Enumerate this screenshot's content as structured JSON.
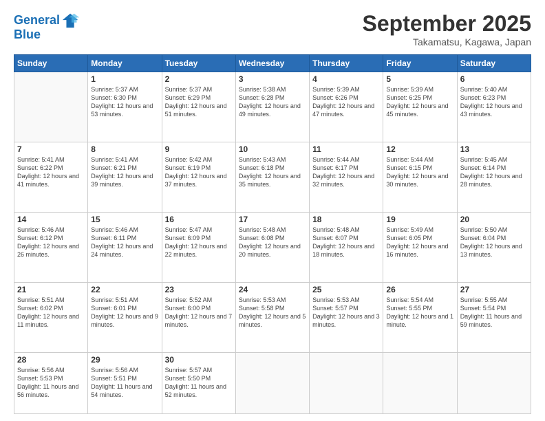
{
  "header": {
    "logo_line1": "General",
    "logo_line2": "Blue",
    "month_year": "September 2025",
    "location": "Takamatsu, Kagawa, Japan"
  },
  "days_of_week": [
    "Sunday",
    "Monday",
    "Tuesday",
    "Wednesday",
    "Thursday",
    "Friday",
    "Saturday"
  ],
  "weeks": [
    [
      {
        "day": "",
        "sunrise": "",
        "sunset": "",
        "daylight": ""
      },
      {
        "day": "1",
        "sunrise": "Sunrise: 5:37 AM",
        "sunset": "Sunset: 6:30 PM",
        "daylight": "Daylight: 12 hours and 53 minutes."
      },
      {
        "day": "2",
        "sunrise": "Sunrise: 5:37 AM",
        "sunset": "Sunset: 6:29 PM",
        "daylight": "Daylight: 12 hours and 51 minutes."
      },
      {
        "day": "3",
        "sunrise": "Sunrise: 5:38 AM",
        "sunset": "Sunset: 6:28 PM",
        "daylight": "Daylight: 12 hours and 49 minutes."
      },
      {
        "day": "4",
        "sunrise": "Sunrise: 5:39 AM",
        "sunset": "Sunset: 6:26 PM",
        "daylight": "Daylight: 12 hours and 47 minutes."
      },
      {
        "day": "5",
        "sunrise": "Sunrise: 5:39 AM",
        "sunset": "Sunset: 6:25 PM",
        "daylight": "Daylight: 12 hours and 45 minutes."
      },
      {
        "day": "6",
        "sunrise": "Sunrise: 5:40 AM",
        "sunset": "Sunset: 6:23 PM",
        "daylight": "Daylight: 12 hours and 43 minutes."
      }
    ],
    [
      {
        "day": "7",
        "sunrise": "Sunrise: 5:41 AM",
        "sunset": "Sunset: 6:22 PM",
        "daylight": "Daylight: 12 hours and 41 minutes."
      },
      {
        "day": "8",
        "sunrise": "Sunrise: 5:41 AM",
        "sunset": "Sunset: 6:21 PM",
        "daylight": "Daylight: 12 hours and 39 minutes."
      },
      {
        "day": "9",
        "sunrise": "Sunrise: 5:42 AM",
        "sunset": "Sunset: 6:19 PM",
        "daylight": "Daylight: 12 hours and 37 minutes."
      },
      {
        "day": "10",
        "sunrise": "Sunrise: 5:43 AM",
        "sunset": "Sunset: 6:18 PM",
        "daylight": "Daylight: 12 hours and 35 minutes."
      },
      {
        "day": "11",
        "sunrise": "Sunrise: 5:44 AM",
        "sunset": "Sunset: 6:17 PM",
        "daylight": "Daylight: 12 hours and 32 minutes."
      },
      {
        "day": "12",
        "sunrise": "Sunrise: 5:44 AM",
        "sunset": "Sunset: 6:15 PM",
        "daylight": "Daylight: 12 hours and 30 minutes."
      },
      {
        "day": "13",
        "sunrise": "Sunrise: 5:45 AM",
        "sunset": "Sunset: 6:14 PM",
        "daylight": "Daylight: 12 hours and 28 minutes."
      }
    ],
    [
      {
        "day": "14",
        "sunrise": "Sunrise: 5:46 AM",
        "sunset": "Sunset: 6:12 PM",
        "daylight": "Daylight: 12 hours and 26 minutes."
      },
      {
        "day": "15",
        "sunrise": "Sunrise: 5:46 AM",
        "sunset": "Sunset: 6:11 PM",
        "daylight": "Daylight: 12 hours and 24 minutes."
      },
      {
        "day": "16",
        "sunrise": "Sunrise: 5:47 AM",
        "sunset": "Sunset: 6:09 PM",
        "daylight": "Daylight: 12 hours and 22 minutes."
      },
      {
        "day": "17",
        "sunrise": "Sunrise: 5:48 AM",
        "sunset": "Sunset: 6:08 PM",
        "daylight": "Daylight: 12 hours and 20 minutes."
      },
      {
        "day": "18",
        "sunrise": "Sunrise: 5:48 AM",
        "sunset": "Sunset: 6:07 PM",
        "daylight": "Daylight: 12 hours and 18 minutes."
      },
      {
        "day": "19",
        "sunrise": "Sunrise: 5:49 AM",
        "sunset": "Sunset: 6:05 PM",
        "daylight": "Daylight: 12 hours and 16 minutes."
      },
      {
        "day": "20",
        "sunrise": "Sunrise: 5:50 AM",
        "sunset": "Sunset: 6:04 PM",
        "daylight": "Daylight: 12 hours and 13 minutes."
      }
    ],
    [
      {
        "day": "21",
        "sunrise": "Sunrise: 5:51 AM",
        "sunset": "Sunset: 6:02 PM",
        "daylight": "Daylight: 12 hours and 11 minutes."
      },
      {
        "day": "22",
        "sunrise": "Sunrise: 5:51 AM",
        "sunset": "Sunset: 6:01 PM",
        "daylight": "Daylight: 12 hours and 9 minutes."
      },
      {
        "day": "23",
        "sunrise": "Sunrise: 5:52 AM",
        "sunset": "Sunset: 6:00 PM",
        "daylight": "Daylight: 12 hours and 7 minutes."
      },
      {
        "day": "24",
        "sunrise": "Sunrise: 5:53 AM",
        "sunset": "Sunset: 5:58 PM",
        "daylight": "Daylight: 12 hours and 5 minutes."
      },
      {
        "day": "25",
        "sunrise": "Sunrise: 5:53 AM",
        "sunset": "Sunset: 5:57 PM",
        "daylight": "Daylight: 12 hours and 3 minutes."
      },
      {
        "day": "26",
        "sunrise": "Sunrise: 5:54 AM",
        "sunset": "Sunset: 5:55 PM",
        "daylight": "Daylight: 12 hours and 1 minute."
      },
      {
        "day": "27",
        "sunrise": "Sunrise: 5:55 AM",
        "sunset": "Sunset: 5:54 PM",
        "daylight": "Daylight: 11 hours and 59 minutes."
      }
    ],
    [
      {
        "day": "28",
        "sunrise": "Sunrise: 5:56 AM",
        "sunset": "Sunset: 5:53 PM",
        "daylight": "Daylight: 11 hours and 56 minutes."
      },
      {
        "day": "29",
        "sunrise": "Sunrise: 5:56 AM",
        "sunset": "Sunset: 5:51 PM",
        "daylight": "Daylight: 11 hours and 54 minutes."
      },
      {
        "day": "30",
        "sunrise": "Sunrise: 5:57 AM",
        "sunset": "Sunset: 5:50 PM",
        "daylight": "Daylight: 11 hours and 52 minutes."
      },
      {
        "day": "",
        "sunrise": "",
        "sunset": "",
        "daylight": ""
      },
      {
        "day": "",
        "sunrise": "",
        "sunset": "",
        "daylight": ""
      },
      {
        "day": "",
        "sunrise": "",
        "sunset": "",
        "daylight": ""
      },
      {
        "day": "",
        "sunrise": "",
        "sunset": "",
        "daylight": ""
      }
    ]
  ]
}
